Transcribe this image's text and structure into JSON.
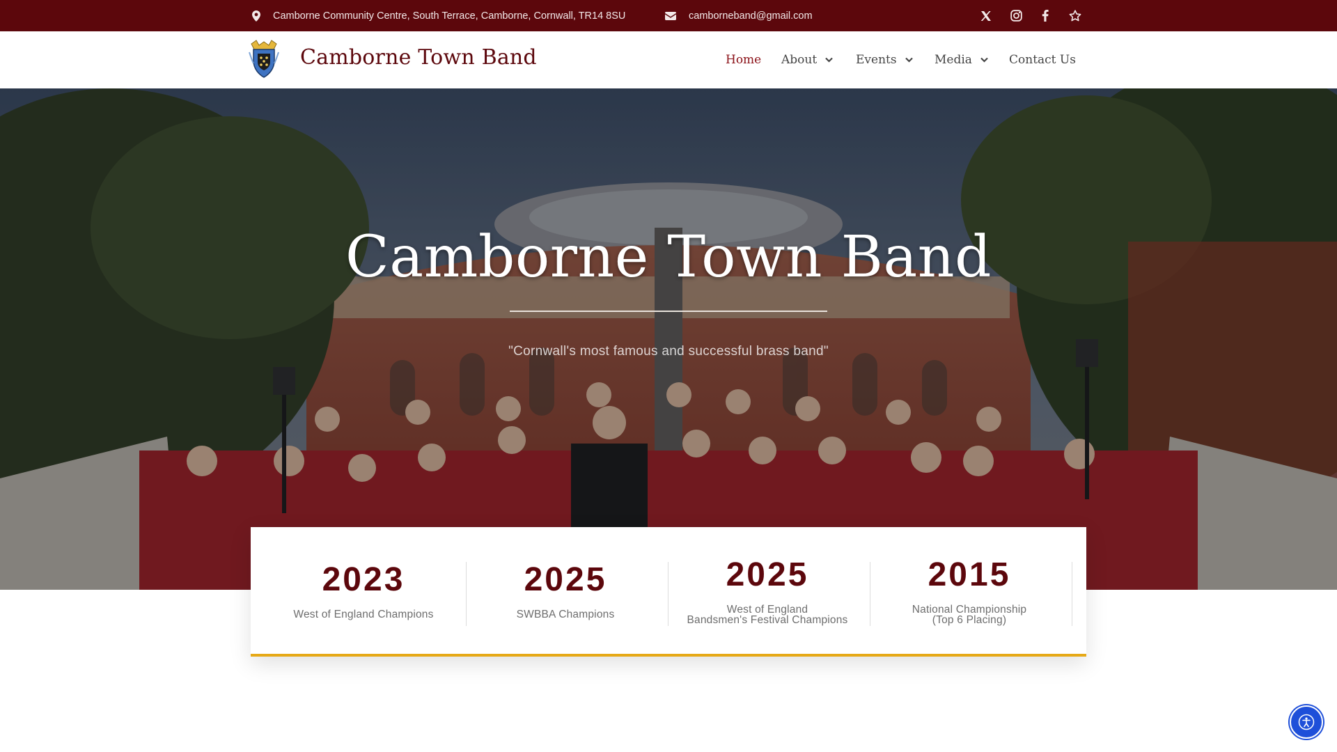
{
  "topbar": {
    "address": "Camborne Community Centre, South Terrace, Camborne, Cornwall, TR14 8SU",
    "email": "camborneband@gmail.com",
    "icons": [
      "map-pin-icon",
      "envelope-icon",
      "x-twitter-icon",
      "instagram-icon",
      "facebook-icon",
      "star-icon"
    ]
  },
  "header": {
    "site_title": "Camborne Town Band",
    "logo": "band-crest-logo",
    "nav": [
      {
        "label": "Home",
        "active": true,
        "dropdown": false
      },
      {
        "label": "About",
        "active": false,
        "dropdown": true
      },
      {
        "label": "Events",
        "active": false,
        "dropdown": true
      },
      {
        "label": "Media",
        "active": false,
        "dropdown": true
      },
      {
        "label": "Contact Us",
        "active": false,
        "dropdown": false
      }
    ]
  },
  "hero": {
    "title": "Camborne Town Band",
    "tagline": "\"Cornwall's most famous and successful brass band\""
  },
  "stats": [
    {
      "year": "2023",
      "label": "West of England Champions"
    },
    {
      "year": "2025",
      "label": "SWBBA Champions"
    },
    {
      "year": "2025",
      "label": "West of England\nBandsmen's Festival Champions"
    },
    {
      "year": "2015",
      "label": "National Championship\n(Top 6 Placing)"
    }
  ],
  "colors": {
    "brand": "#5c070c",
    "accent": "#e6a917",
    "accessibility": "#1e4fd9"
  },
  "accessibility": {
    "icon": "accessibility-icon"
  }
}
